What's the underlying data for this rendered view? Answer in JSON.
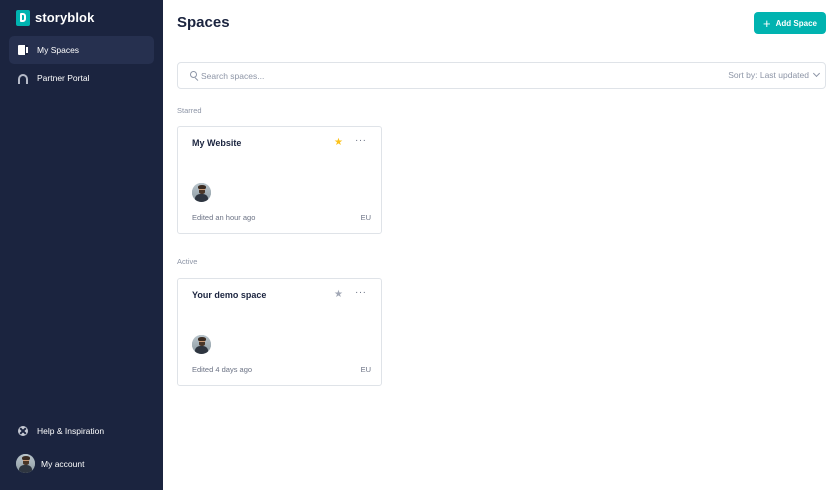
{
  "brand": {
    "name": "storyblok",
    "accent": "#00b3b0",
    "sidebar_bg": "#1b243f"
  },
  "sidebar": {
    "items": [
      {
        "label": "My Spaces",
        "icon": "spaces-icon",
        "active": true
      },
      {
        "label": "Partner Portal",
        "icon": "partner-portal-icon",
        "active": false
      }
    ],
    "help_label": "Help & Inspiration",
    "account_label": "My account"
  },
  "main": {
    "title": "Spaces",
    "add_button_label": "Add Space",
    "search": {
      "placeholder": "Search spaces...",
      "value": ""
    },
    "sort_label": "Sort by: Last updated",
    "sections": [
      {
        "label": "Starred",
        "spaces": [
          {
            "name": "My Website",
            "starred": true,
            "edited": "Edited an hour ago",
            "region": "EU"
          }
        ]
      },
      {
        "label": "Active",
        "spaces": [
          {
            "name": "Your demo space",
            "starred": false,
            "edited": "Edited 4 days ago",
            "region": "EU"
          }
        ]
      }
    ]
  }
}
